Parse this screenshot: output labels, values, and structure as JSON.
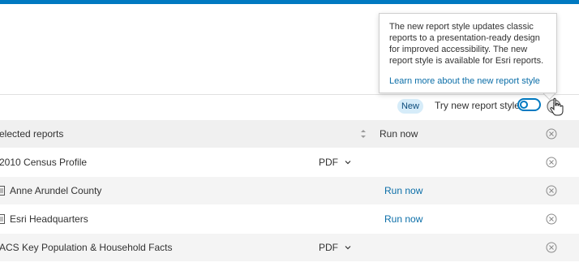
{
  "popover": {
    "text": "The new report style updates classic reports to a presentation-ready design for improved accessibility. The new report style is available for Esri reports.",
    "link": "Learn more about the new report style"
  },
  "toolbar": {
    "badge": "New",
    "toggle_label": "Try new report style",
    "toggle_on": false
  },
  "table": {
    "header": {
      "col1": "elected reports",
      "col2": "Run now"
    },
    "rows": [
      {
        "name": "2010 Census Profile",
        "format": "PDF",
        "run": ""
      },
      {
        "name": "Anne Arundel County",
        "format": "",
        "run": "Run now"
      },
      {
        "name": "Esri Headquarters",
        "format": "",
        "run": "Run now"
      },
      {
        "name": "ACS Key Population & Household Facts",
        "format": "PDF",
        "run": ""
      }
    ]
  },
  "colors": {
    "accent": "#0079c1",
    "link": "#0b6ea8",
    "badge_bg": "#d6ecf9"
  },
  "icons": [
    "sort-icon",
    "chevron-down-icon",
    "remove-icon",
    "document-icon",
    "info-icon",
    "hand-cursor-icon"
  ]
}
